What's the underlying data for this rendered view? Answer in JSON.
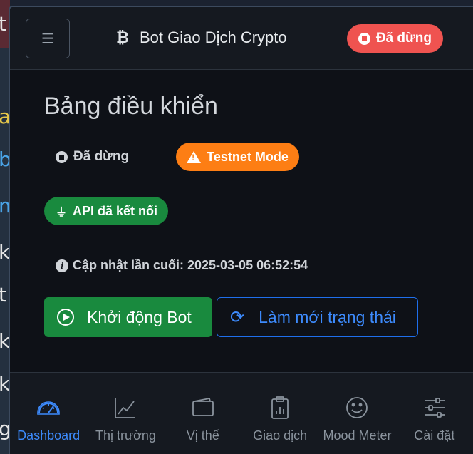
{
  "background_editor": {
    "chars": [
      "t",
      "a",
      "b",
      "m",
      "k",
      "t",
      "k",
      "k",
      "g"
    ]
  },
  "header": {
    "menu_icon": "hamburger-icon",
    "brand_icon": "bitcoin-icon",
    "brand_glyph": "₿",
    "title": "Bot Giao Dịch Crypto",
    "status_label": "Đã dừng",
    "status_color": "#ef5350"
  },
  "dashboard": {
    "title": "Bảng điều khiển",
    "status_text": "Đã dừng",
    "testnet_label": "Testnet Mode",
    "testnet_color": "#fd7e14",
    "api_label": "API đã kết nối",
    "api_color": "#198a3e",
    "updated_label": "Cập nhật lần cuối: 2025-03-05 06:52:54",
    "start_button": "Khởi động Bot",
    "refresh_button": "Làm mới trạng thái",
    "accent_blue": "#3d8bfd"
  },
  "nav": {
    "items": [
      {
        "label": "Dashboard",
        "icon": "speedometer-icon",
        "active": true
      },
      {
        "label": "Thị trường",
        "icon": "chart-line-icon",
        "active": false
      },
      {
        "label": "Vị thế",
        "icon": "wallet-icon",
        "active": false
      },
      {
        "label": "Giao dịch",
        "icon": "clipboard-data-icon",
        "active": false
      },
      {
        "label": "Mood Meter",
        "icon": "emoji-smile-icon",
        "active": false
      },
      {
        "label": "Cài đặt",
        "icon": "sliders-icon",
        "active": false
      }
    ]
  }
}
